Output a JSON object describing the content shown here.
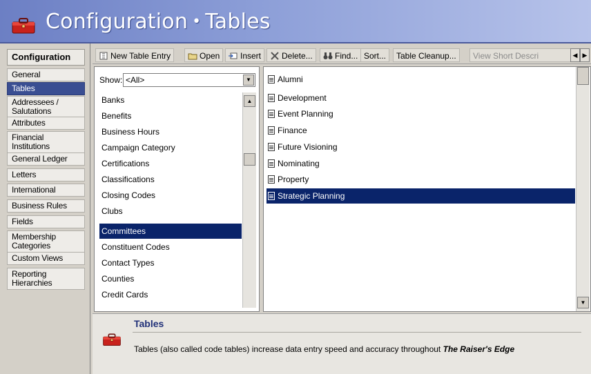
{
  "window": {
    "title_part1": "Configuration",
    "title_sep": "•",
    "title_part2": "Tables"
  },
  "nav": {
    "header": "Configuration",
    "items": [
      {
        "label": "General"
      },
      {
        "label": "Tables",
        "selected": true
      },
      {
        "label": "Addressees /",
        "label2": "Salutations"
      },
      {
        "label": "Attributes"
      },
      {
        "label": "Financial",
        "label2": "Institutions"
      },
      {
        "label": "General Ledger"
      },
      {
        "label": "Letters"
      },
      {
        "label": "International"
      },
      {
        "label": "Business Rules"
      },
      {
        "label": "Fields"
      },
      {
        "label": "Membership",
        "label2": "Categories"
      },
      {
        "label": "Custom Views"
      },
      {
        "label": "Reporting",
        "label2": "Hierarchies"
      }
    ]
  },
  "toolbar": {
    "new_entry": "New Table Entry",
    "open": "Open",
    "insert": "Insert",
    "delete": "Delete...",
    "find": "Find...",
    "sort": "Sort...",
    "cleanup": "Table Cleanup...",
    "short_desc": "View Short Descri"
  },
  "show": {
    "label": "Show:",
    "value": "<All>"
  },
  "tables_list": [
    "Banks",
    "Benefits",
    "Business Hours",
    "Campaign Category",
    "Certifications",
    "Classifications",
    "Closing Codes",
    "Clubs",
    "Committees",
    "Constituent Codes",
    "Contact Types",
    "Counties",
    "Credit Cards"
  ],
  "tables_list_selected": "Committees",
  "entries": [
    "Alumni",
    "Development",
    "Event Planning",
    "Finance",
    "Future Visioning",
    "Nominating",
    "Property",
    "Strategic Planning"
  ],
  "entries_selected": "Strategic Planning",
  "description": {
    "title": "Tables",
    "text": "Tables (also called code tables) increase data entry speed and accuracy throughout",
    "product": "The Raiser's Edge"
  },
  "colors": {
    "title_gradient_start": "#6c7fc4",
    "selection": "#0a246a",
    "nav_selection": "#3a4e92",
    "desc_title": "#1f2f78"
  }
}
